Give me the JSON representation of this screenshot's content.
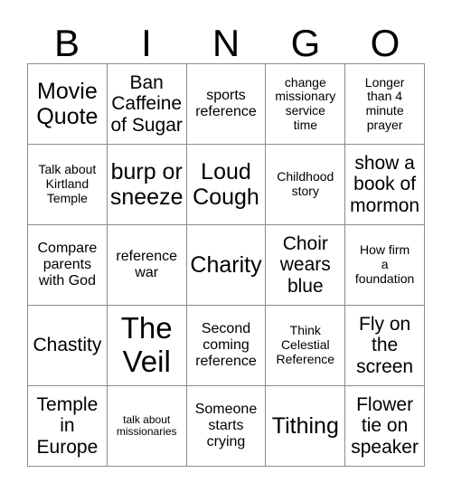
{
  "card": {
    "title_letters": [
      "B",
      "I",
      "N",
      "G",
      "O"
    ],
    "grid_size": "5x5",
    "colors": {
      "background": "#ffffff",
      "text": "#000000",
      "grid_line": "#8c8c8c"
    },
    "rows": [
      [
        {
          "text": "Movie\nQuote",
          "size": "xl"
        },
        {
          "text": "Ban\nCaffeine\nof Sugar",
          "size": "lg"
        },
        {
          "text": "sports\nreference",
          "size": "md"
        },
        {
          "text": "change\nmissionary\nservice\ntime",
          "size": "sm"
        },
        {
          "text": "Longer\nthan 4\nminute\nprayer",
          "size": "sm"
        }
      ],
      [
        {
          "text": "Talk about\nKirtland\nTemple",
          "size": "sm"
        },
        {
          "text": "burp or\nsneeze",
          "size": "xl"
        },
        {
          "text": "Loud\nCough",
          "size": "xl"
        },
        {
          "text": "Childhood\nstory",
          "size": "sm"
        },
        {
          "text": "show a\nbook of\nmormon",
          "size": "lg"
        }
      ],
      [
        {
          "text": "Compare\nparents\nwith God",
          "size": "md"
        },
        {
          "text": "reference\nwar",
          "size": "md"
        },
        {
          "text": "Charity",
          "size": "xl"
        },
        {
          "text": "Choir\nwears\nblue",
          "size": "lg"
        },
        {
          "text": "How firm\na\nfoundation",
          "size": "sm"
        }
      ],
      [
        {
          "text": "Chastity",
          "size": "lg"
        },
        {
          "text": "The\nVeil",
          "size": "xxl"
        },
        {
          "text": "Second\ncoming\nreference",
          "size": "md"
        },
        {
          "text": "Think\nCelestial\nReference",
          "size": "sm"
        },
        {
          "text": "Fly on\nthe\nscreen",
          "size": "lg"
        }
      ],
      [
        {
          "text": "Temple\nin\nEurope",
          "size": "lg"
        },
        {
          "text": "talk about\nmissionaries",
          "size": "xs"
        },
        {
          "text": "Someone\nstarts\ncrying",
          "size": "md"
        },
        {
          "text": "Tithing",
          "size": "xl"
        },
        {
          "text": "Flower\ntie on\nspeaker",
          "size": "lg"
        }
      ]
    ]
  }
}
